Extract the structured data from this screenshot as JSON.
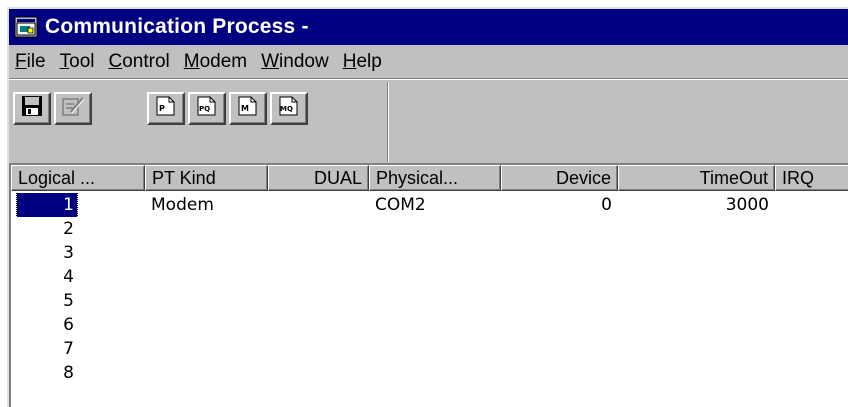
{
  "window": {
    "title": "Communication Process -",
    "icon": "app-window-icon"
  },
  "menu": [
    {
      "label": "File",
      "mnemonic": "F",
      "rest": "ile"
    },
    {
      "label": "Tool",
      "mnemonic": "T",
      "rest": "ool"
    },
    {
      "label": "Control",
      "mnemonic": "C",
      "rest": "ontrol"
    },
    {
      "label": "Modem",
      "mnemonic": "M",
      "rest": "odem"
    },
    {
      "label": "Window",
      "mnemonic": "W",
      "rest": "indow"
    },
    {
      "label": "Help",
      "mnemonic": "H",
      "rest": "elp"
    }
  ],
  "toolbar": {
    "buttons": [
      {
        "icon": "save-icon",
        "enabled": true
      },
      {
        "icon": "edit-icon",
        "enabled": false
      },
      {
        "icon": "page-p-icon",
        "glyph": "P",
        "enabled": true
      },
      {
        "icon": "page-pq-icon",
        "glyph": "PQ",
        "enabled": true
      },
      {
        "icon": "page-m-icon",
        "glyph": "M",
        "enabled": true
      },
      {
        "icon": "page-mq-icon",
        "glyph": "MQ",
        "enabled": true
      }
    ]
  },
  "table": {
    "columns": [
      "Logical ...",
      "PT Kind",
      "DUAL",
      "Physical...",
      "Device",
      "TimeOut",
      "IRQ"
    ],
    "rows": [
      {
        "logical": "1",
        "kind": "Modem",
        "dual": "",
        "physical": "COM2",
        "device": "0",
        "timeout": "3000",
        "irq": "",
        "selected": true
      },
      {
        "logical": "2",
        "kind": "",
        "dual": "",
        "physical": "",
        "device": "",
        "timeout": "",
        "irq": ""
      },
      {
        "logical": "3",
        "kind": "",
        "dual": "",
        "physical": "",
        "device": "",
        "timeout": "",
        "irq": ""
      },
      {
        "logical": "4",
        "kind": "",
        "dual": "",
        "physical": "",
        "device": "",
        "timeout": "",
        "irq": ""
      },
      {
        "logical": "5",
        "kind": "",
        "dual": "",
        "physical": "",
        "device": "",
        "timeout": "",
        "irq": ""
      },
      {
        "logical": "6",
        "kind": "",
        "dual": "",
        "physical": "",
        "device": "",
        "timeout": "",
        "irq": ""
      },
      {
        "logical": "7",
        "kind": "",
        "dual": "",
        "physical": "",
        "device": "",
        "timeout": "",
        "irq": ""
      },
      {
        "logical": "8",
        "kind": "",
        "dual": "",
        "physical": "",
        "device": "",
        "timeout": "",
        "irq": ""
      }
    ]
  },
  "colors": {
    "titlebar": "#000080",
    "face": "#c0c0c0",
    "selection": "#000080"
  }
}
